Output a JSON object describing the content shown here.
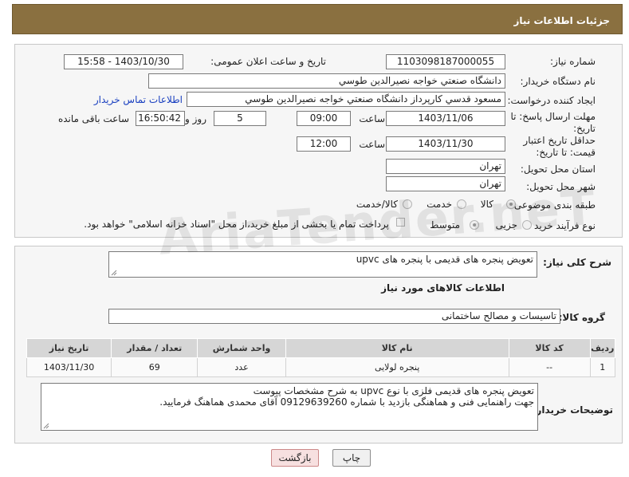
{
  "header": {
    "title": "جزئیات اطلاعات نیاز"
  },
  "fields": {
    "need_number_label": "شماره نیاز:",
    "need_number": "1103098187000055",
    "announce_label": "تاریخ و ساعت اعلان عمومی:",
    "announce_value": "1403/10/30 - 15:58",
    "buyer_org_label": "نام دستگاه خریدار:",
    "buyer_org": "دانشگاه صنعتي خواجه نصيرالدين طوسي",
    "creator_label": "ایجاد کننده درخواست:",
    "creator": "مسعود قدسي کارپرداز دانشگاه صنعتي خواجه نصيرالدين طوسي",
    "contact_link": "اطلاعات تماس خریدار",
    "reply_deadline_label": "مهلت ارسال پاسخ: تا تاریخ:",
    "reply_date": "1403/11/06",
    "time_label": "ساعت",
    "reply_time": "09:00",
    "days_value": "5",
    "days_label": "روز و",
    "remaining_time": "16:50:42",
    "remaining_label": "ساعت باقی مانده",
    "validity_label": "حداقل تاریخ اعتبار قیمت: تا تاریخ:",
    "validity_date": "1403/11/30",
    "validity_time": "12:00",
    "province_label": "استان محل تحویل:",
    "province": "تهران",
    "city_label": "شهر محل تحویل:",
    "city": "تهران",
    "category_label": "طبقه بندی موضوعی:",
    "category_options": [
      "کالا",
      "خدمت",
      "کالا/خدمت"
    ],
    "process_label": "نوع فرآیند خرید :",
    "process_options": [
      "جزیی",
      "متوسط"
    ],
    "payment_note": "پرداخت تمام یا بخشی از مبلغ خرید،از محل \"اسناد خزانه اسلامی\" خواهد بود."
  },
  "description": {
    "label": "شرح کلی نیاز:",
    "value": "تعویض پنجره های قدیمی با پنجره های upvc"
  },
  "goods_info_title": "اطلاعات کالاهای مورد نیاز",
  "goods_group": {
    "label": "گروه کالا:",
    "value": "تاسیسات و مصالح ساختمانی"
  },
  "table": {
    "headers": [
      "ردیف",
      "کد کالا",
      "نام کالا",
      "واحد شمارش",
      "تعداد / مقدار",
      "تاریخ نیاز"
    ],
    "rows": [
      [
        "1",
        "--",
        "پنجره لولایی",
        "عدد",
        "69",
        "1403/11/30"
      ]
    ]
  },
  "buyer_notes": {
    "label": "توضیحات خریدار:",
    "line1": "تعویض پنجره های قدیمی فلزی با نوع upvc به شرح مشخصات پیوست",
    "line2": "جهت راهنمایی فنی و هماهنگی بازدید با شماره 09129639260 آقای محمدی هماهنگ فرمایید."
  },
  "buttons": {
    "print": "چاپ",
    "back": "بازگشت"
  },
  "watermark": "AriaTender.neT"
}
